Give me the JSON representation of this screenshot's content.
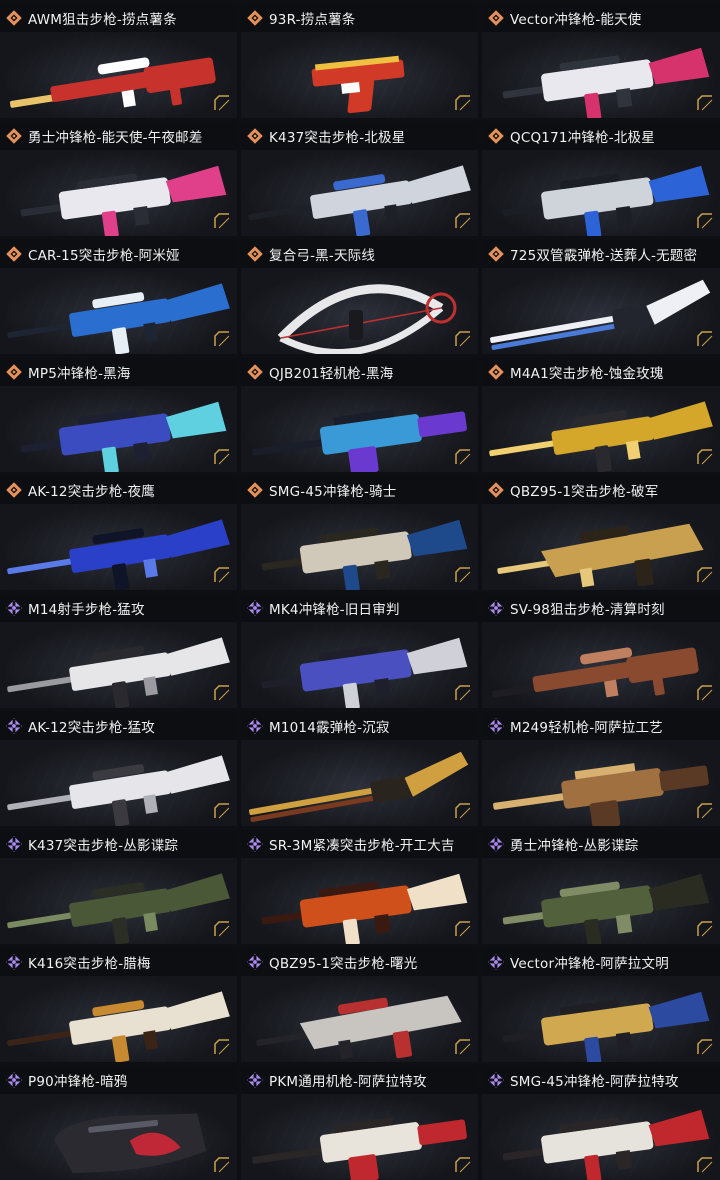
{
  "items": [
    {
      "title": "AWM狙击步枪-捞点薯条",
      "rarity": "gold",
      "colors": [
        "#c8322c",
        "#e8c36a",
        "#ffffff"
      ],
      "shape": "sniper"
    },
    {
      "title": "93R-捞点薯条",
      "rarity": "gold",
      "colors": [
        "#d23a28",
        "#f0c040",
        "#ffffff"
      ],
      "shape": "pistol"
    },
    {
      "title": "Vector冲锋枪-能天使",
      "rarity": "gold",
      "colors": [
        "#e8e8ee",
        "#d6336c",
        "#30343c"
      ],
      "shape": "smg"
    },
    {
      "title": "勇士冲锋枪-能天使-午夜邮差",
      "rarity": "gold",
      "colors": [
        "#e8e8ee",
        "#e0408a",
        "#2a2d36"
      ],
      "shape": "smg"
    },
    {
      "title": "K437突击步枪-北极星",
      "rarity": "gold",
      "colors": [
        "#d0d4dc",
        "#3a6ad0",
        "#1e2028"
      ],
      "shape": "rifle"
    },
    {
      "title": "QCQ171冲锋枪-北极星",
      "rarity": "gold",
      "colors": [
        "#cfd3da",
        "#2c64d8",
        "#1c1e25"
      ],
      "shape": "smg"
    },
    {
      "title": "CAR-15突击步枪-阿米娅",
      "rarity": "gold",
      "colors": [
        "#2a6fd0",
        "#e8eef5",
        "#1d2532"
      ],
      "shape": "rifle"
    },
    {
      "title": "复合弓-黑-天际线",
      "rarity": "gold",
      "colors": [
        "#e8e8ea",
        "#c03030",
        "#1a1a1e"
      ],
      "shape": "bow"
    },
    {
      "title": "725双管霰弹枪-送葬人-无题密",
      "rarity": "gold",
      "colors": [
        "#eef0f6",
        "#4a7ad8",
        "#22252e"
      ],
      "shape": "shotgun"
    },
    {
      "title": "MP5冲锋枪-黑海",
      "rarity": "gold",
      "colors": [
        "#3a4cc0",
        "#5fd0e0",
        "#1d2030"
      ],
      "shape": "smg"
    },
    {
      "title": "QJB201轻机枪-黑海",
      "rarity": "gold",
      "colors": [
        "#3a9ad8",
        "#6a3ad0",
        "#1a1d2a"
      ],
      "shape": "lmg"
    },
    {
      "title": "M4A1突击步枪-蚀金玫瑰",
      "rarity": "gold",
      "colors": [
        "#d4a62a",
        "#2a2a2e",
        "#f0d070"
      ],
      "shape": "rifle"
    },
    {
      "title": "AK-12突击步枪-夜鹰",
      "rarity": "gold",
      "colors": [
        "#2a40c8",
        "#101428",
        "#5a7ae8"
      ],
      "shape": "rifle"
    },
    {
      "title": "SMG-45冲锋枪-骑士",
      "rarity": "gold",
      "colors": [
        "#d0c8b8",
        "#1e4a8c",
        "#2a2620"
      ],
      "shape": "smg"
    },
    {
      "title": "QBZ95-1突击步枪-破军",
      "rarity": "gold",
      "colors": [
        "#c8a050",
        "#2c2418",
        "#e6c87a"
      ],
      "shape": "bullpup"
    },
    {
      "title": "M14射手步枪-猛攻",
      "rarity": "purple",
      "colors": [
        "#e6e6e8",
        "#2a2a2e",
        "#9a9aa0"
      ],
      "shape": "rifle"
    },
    {
      "title": "MK4冲锋枪-旧日审判",
      "rarity": "purple",
      "colors": [
        "#4a50c0",
        "#d0d0d8",
        "#1e1f2a"
      ],
      "shape": "smg"
    },
    {
      "title": "SV-98狙击步枪-清算时刻",
      "rarity": "purple",
      "colors": [
        "#8a4a30",
        "#1e1e22",
        "#c08060"
      ],
      "shape": "sniper"
    },
    {
      "title": "AK-12突击步枪-猛攻",
      "rarity": "purple",
      "colors": [
        "#e6e6ea",
        "#3a3a40",
        "#b0b0b8"
      ],
      "shape": "rifle"
    },
    {
      "title": "M1014霰弹枪-沉寂",
      "rarity": "purple",
      "colors": [
        "#d0a040",
        "#7a3a20",
        "#2a241e"
      ],
      "shape": "shotgun"
    },
    {
      "title": "M249轻机枪-阿萨拉工艺",
      "rarity": "purple",
      "colors": [
        "#a07040",
        "#5a3a24",
        "#d8b070"
      ],
      "shape": "lmg"
    },
    {
      "title": "K437突击步枪-丛影谍踪",
      "rarity": "purple",
      "colors": [
        "#4a5838",
        "#2a2e24",
        "#7a8a60"
      ],
      "shape": "rifle"
    },
    {
      "title": "SR-3M紧凑突击步枪-开工大吉",
      "rarity": "purple",
      "colors": [
        "#d0501c",
        "#f0e0c8",
        "#3a1a10"
      ],
      "shape": "smg"
    },
    {
      "title": "勇士冲锋枪-丛影谍踪",
      "rarity": "purple",
      "colors": [
        "#52603c",
        "#2a2c22",
        "#808c66"
      ],
      "shape": "smg"
    },
    {
      "title": "K416突击步枪-腊梅",
      "rarity": "purple",
      "colors": [
        "#e8e0d0",
        "#c88a30",
        "#3a2418"
      ],
      "shape": "rifle"
    },
    {
      "title": "QBZ95-1突击步枪-曙光",
      "rarity": "purple",
      "colors": [
        "#c8c4c0",
        "#b83030",
        "#24232a"
      ],
      "shape": "bullpup"
    },
    {
      "title": "Vector冲锋枪-阿萨拉文明",
      "rarity": "purple",
      "colors": [
        "#d0a850",
        "#2c4aa0",
        "#1e1e24"
      ],
      "shape": "smg"
    },
    {
      "title": "P90冲锋枪-暗鸦",
      "rarity": "purple",
      "colors": [
        "#2a2a30",
        "#c02838",
        "#5a5a66"
      ],
      "shape": "p90"
    },
    {
      "title": "PKM通用机枪-阿萨拉特攻",
      "rarity": "purple",
      "colors": [
        "#e8e4dc",
        "#c02830",
        "#2a2626"
      ],
      "shape": "lmg"
    },
    {
      "title": "SMG-45冲锋枪-阿萨拉特攻",
      "rarity": "purple",
      "colors": [
        "#e6e2dc",
        "#c0282e",
        "#2a2628"
      ],
      "shape": "smg"
    }
  ],
  "rarity_colors": {
    "gold": "#e4915a",
    "purple": "#a98af0"
  }
}
